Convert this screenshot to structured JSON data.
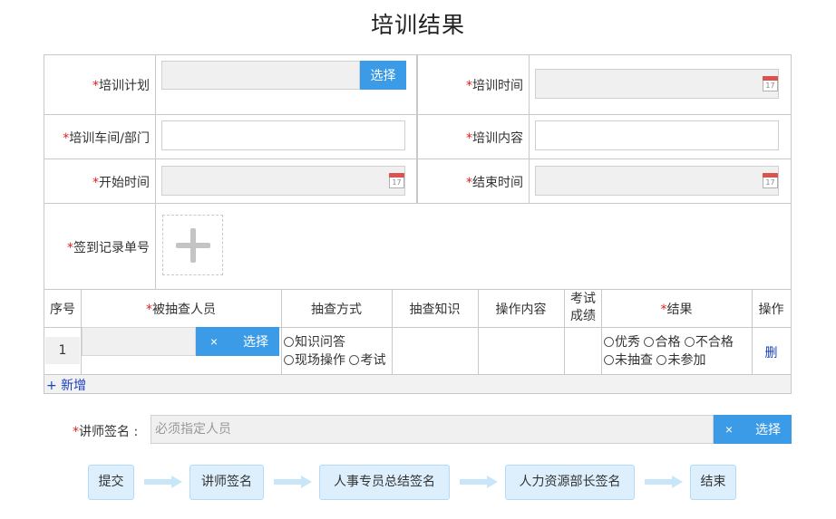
{
  "page": {
    "title": "培训结果"
  },
  "form": {
    "required_mark": "*",
    "plan": {
      "label": "培训计划",
      "value": "",
      "select_label": "选择"
    },
    "time": {
      "label": "培训时间",
      "value": ""
    },
    "dept": {
      "label": "培训车间/部门",
      "value": ""
    },
    "content": {
      "label": "培训内容",
      "value": ""
    },
    "start": {
      "label": "开始时间",
      "value": ""
    },
    "end": {
      "label": "结束时间",
      "value": ""
    },
    "signin": {
      "label": "签到记录单号"
    },
    "calendar_day": "17"
  },
  "table": {
    "headers": {
      "seq": "序号",
      "person": "被抽查人员",
      "method": "抽查方式",
      "knowledge": "抽查知识",
      "operation": "操作内容",
      "score": "考试成绩",
      "result": "结果",
      "action": "操作"
    },
    "rows": [
      {
        "seq": "1",
        "person_value": "",
        "clear_label": "×",
        "select_label": "选择",
        "method_options": [
          "知识问答",
          "现场操作",
          "考试"
        ],
        "result_options": [
          "优秀",
          "合格",
          "不合格",
          "未抽查",
          "未参加"
        ],
        "delete_label": "删"
      }
    ],
    "add_label": "+ 新增"
  },
  "teacher": {
    "label": "讲师签名 :",
    "placeholder": "必须指定人员",
    "clear_label": "×",
    "select_label": "选择"
  },
  "flow": {
    "steps": [
      "提交",
      "讲师签名",
      "人事专员总结签名",
      "人力资源部长签名",
      "结束"
    ]
  },
  "colors": {
    "accent": "#3c9be6",
    "required": "#e02020",
    "link": "#1a3fbf",
    "flow_node_bg": "#ddeffc",
    "field_disabled_bg": "#f0f0f0"
  }
}
